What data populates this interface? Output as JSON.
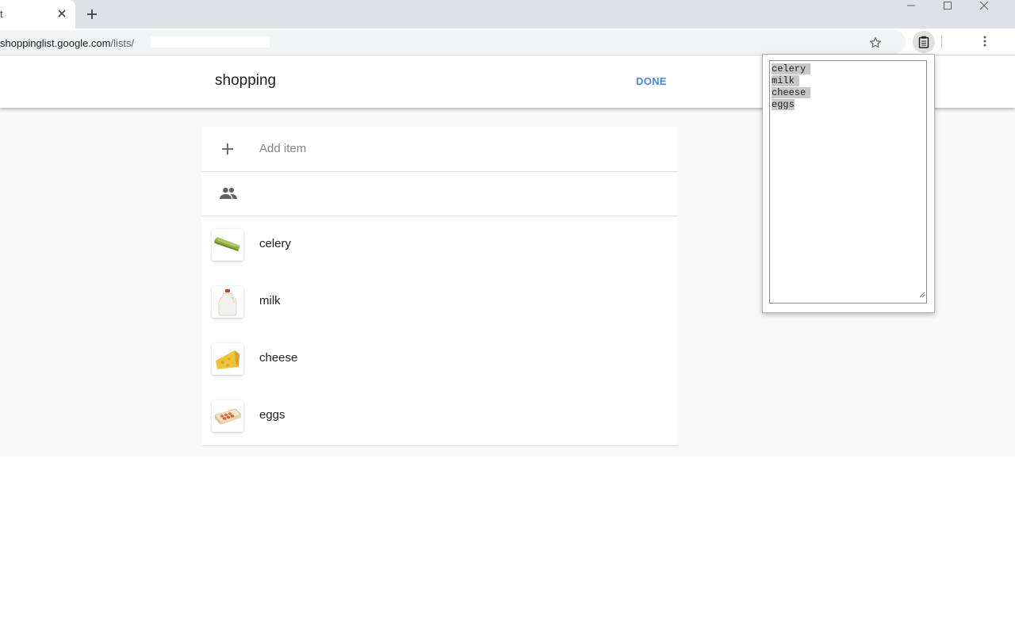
{
  "browser": {
    "tab_title": "t",
    "url_host": "shoppinglist.google.com",
    "url_path": "/lists/"
  },
  "app": {
    "list_title": "shopping",
    "done_label": "DONE",
    "add_item_placeholder": "Add item",
    "accent_color": "#4285f4"
  },
  "items": [
    {
      "label": "celery",
      "icon": "celery-image"
    },
    {
      "label": "milk",
      "icon": "milk-jug-image"
    },
    {
      "label": "cheese",
      "icon": "cheese-wedge-image"
    },
    {
      "label": "eggs",
      "icon": "egg-carton-image"
    }
  ],
  "popup": {
    "lines": [
      "celery",
      "milk",
      "cheese",
      "eggs"
    ]
  }
}
